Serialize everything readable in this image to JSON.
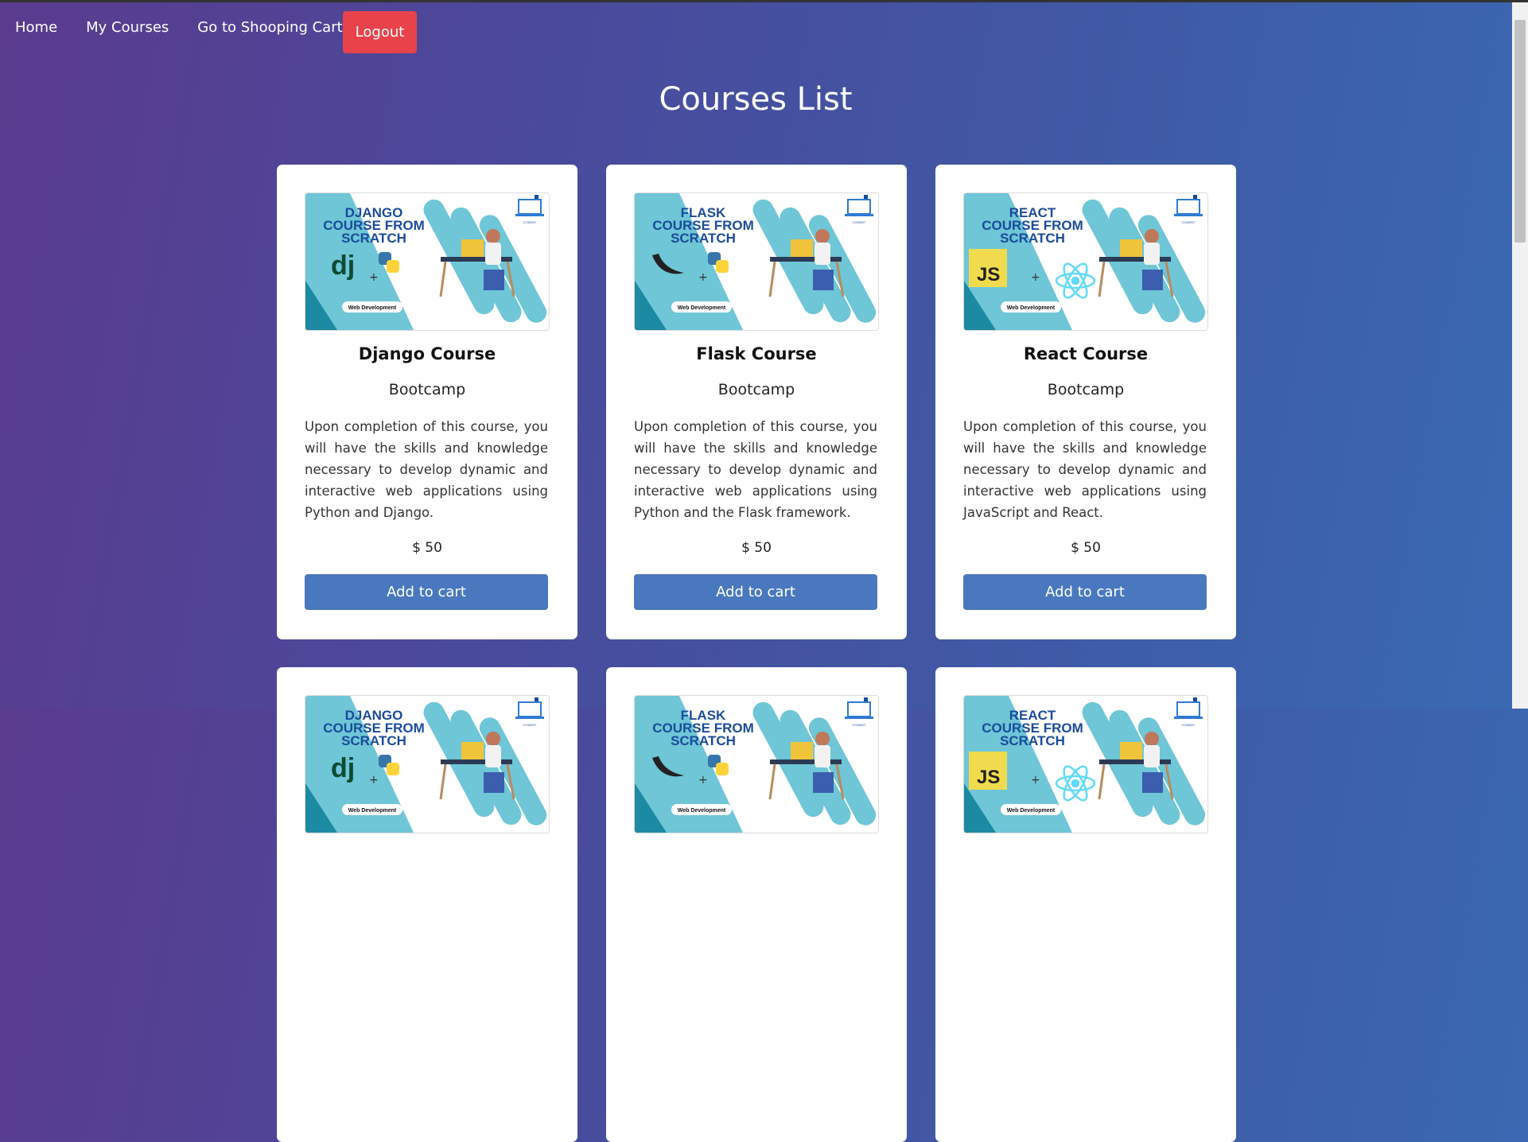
{
  "nav": {
    "home": "Home",
    "my_courses": "My Courses",
    "cart": "Go to Shooping Cart",
    "logout": "Logout"
  },
  "page_title": "Courses List",
  "courses": [
    {
      "thumb_lines": [
        "DJANGO",
        "COURSE FROM",
        "SCRATCH"
      ],
      "thumb_tag": "Web Development",
      "name": "Django Course",
      "subtitle": "Bootcamp",
      "description": "Upon completion of this course, you will have the skills and knowledge necessary to develop dynamic and interactive web applications using Python and Django.",
      "price": "$ 50",
      "button": "Add to cart"
    },
    {
      "thumb_lines": [
        "FLASK",
        "COURSE FROM",
        "SCRATCH"
      ],
      "thumb_tag": "Web Development",
      "name": "Flask Course",
      "subtitle": "Bootcamp",
      "description": "Upon completion of this course, you will have the skills and knowledge necessary to develop dynamic and interactive web applications using Python and the Flask framework.",
      "price": "$ 50",
      "button": "Add to cart"
    },
    {
      "thumb_lines": [
        "REACT",
        "COURSE FROM",
        "SCRATCH"
      ],
      "thumb_tag": "Web Development",
      "name": "React Course",
      "subtitle": "Bootcamp",
      "description": "Upon completion of this course, you will have the skills and knowledge necessary to develop dynamic and interactive web applications using JavaScript and React.",
      "price": "$ 50",
      "button": "Add to cart"
    }
  ],
  "thumb_logo_icons": [
    "django-dj-logo-icon",
    "flask-horn-logo-icon",
    "javascript-js-logo-icon"
  ],
  "thumb_plus": "+",
  "thumb_js": "JS",
  "thumb_dj": "dj",
  "colors": {
    "logout": "#e8434a",
    "cart_button": "#4a78be",
    "thumb_teal": "#6ec6d6"
  }
}
